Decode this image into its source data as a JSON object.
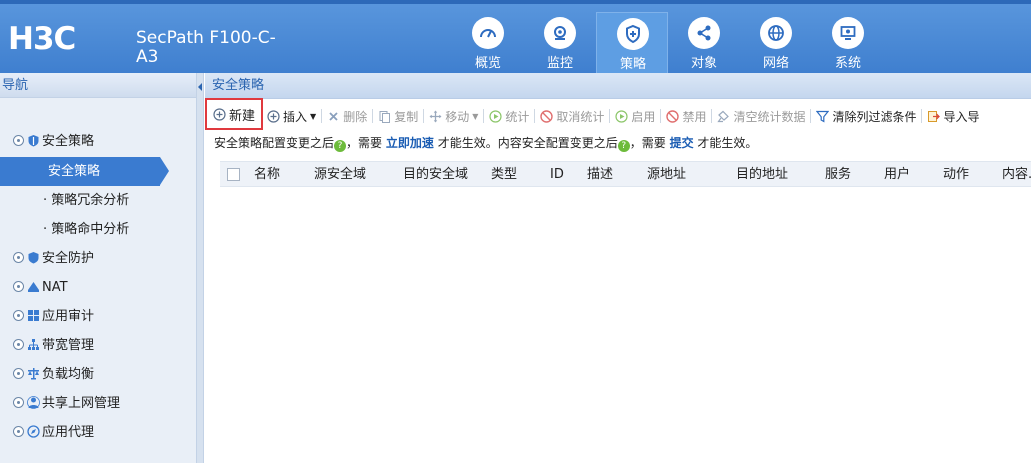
{
  "header": {
    "logo": "H3C",
    "product_line1": "SecPath F100-C-",
    "product_line2": "A3",
    "tabs": [
      {
        "label": "概览",
        "icon": "dashboard-icon",
        "active": false
      },
      {
        "label": "监控",
        "icon": "monitor-icon",
        "active": false
      },
      {
        "label": "策略",
        "icon": "shield-icon",
        "active": true
      },
      {
        "label": "对象",
        "icon": "share-icon",
        "active": false
      },
      {
        "label": "网络",
        "icon": "globe-icon",
        "active": false
      },
      {
        "label": "系统",
        "icon": "system-icon",
        "active": false
      }
    ],
    "colors": {
      "bar": "#4a8ad6",
      "active_tab": "#5e9ee3"
    }
  },
  "sidebar": {
    "title": "导航",
    "items": [
      {
        "label": "安全策略",
        "icon": "shield-icon"
      },
      {
        "label": "安全防护",
        "icon": "shield-small-icon"
      },
      {
        "label": "NAT",
        "icon": "nat-icon"
      },
      {
        "label": "应用审计",
        "icon": "grid-icon"
      },
      {
        "label": "带宽管理",
        "icon": "hierarchy-icon"
      },
      {
        "label": "负载均衡",
        "icon": "balance-icon"
      },
      {
        "label": "共享上网管理",
        "icon": "users-icon"
      },
      {
        "label": "应用代理",
        "icon": "compass-icon"
      }
    ],
    "sub_items": [
      {
        "label": "安全策略",
        "active": true
      },
      {
        "label": "策略冗余分析",
        "active": false
      },
      {
        "label": "策略命中分析",
        "active": false
      }
    ]
  },
  "main": {
    "breadcrumb": "安全策略",
    "toolbar": {
      "new": "新建",
      "insert": "插入",
      "delete": "删除",
      "copy": "复制",
      "move": "移动",
      "stats": "统计",
      "cancel_stats": "取消统计",
      "enable": "启用",
      "disable": "禁用",
      "clear_stats": "清空统计数据",
      "clear_filter": "清除列过滤条件",
      "import": "导入导"
    },
    "notice": {
      "part1": "安全策略配置变更之后",
      "part2": "，需要",
      "link1": "立即加速",
      "part3": "才能生效。内容安全配置变更之后",
      "part4": "，需要",
      "link2": "提交",
      "part5": "才能生效。"
    },
    "columns": [
      "名称",
      "源安全域",
      "目的安全域",
      "类型",
      "ID",
      "描述",
      "源地址",
      "目的地址",
      "服务",
      "用户",
      "动作",
      "内容..."
    ]
  }
}
